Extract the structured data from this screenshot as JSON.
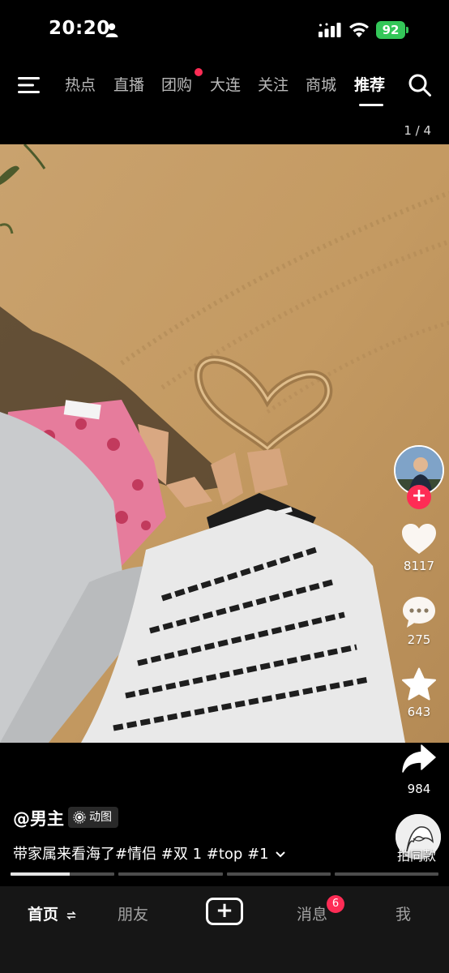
{
  "status_bar": {
    "time": "20:20",
    "battery": "92"
  },
  "top_nav": {
    "tabs": [
      {
        "label": "热点"
      },
      {
        "label": "直播"
      },
      {
        "label": "团购",
        "has_dot": true
      },
      {
        "label": "大连"
      },
      {
        "label": "关注"
      },
      {
        "label": "商城"
      },
      {
        "label": "推荐",
        "active": true
      }
    ],
    "page_indicator": "1 / 4"
  },
  "rail": {
    "likes": "8117",
    "comments": "275",
    "favorites": "643",
    "shares": "984"
  },
  "post": {
    "author": "@男主",
    "badge": "动图",
    "caption": "带家属来看海了#情侣 #双 1 #top #1",
    "same_style": "拍同款",
    "progress": {
      "segments": 4,
      "current": 1,
      "current_fill": 0.57
    }
  },
  "bottom_tabs": {
    "home": "首页",
    "friends": "朋友",
    "messages": "消息",
    "messages_badge": "6",
    "me": "我"
  },
  "colors": {
    "accent": "#fe2c55",
    "battery": "#34c759",
    "tabbar_bg": "#161616"
  }
}
